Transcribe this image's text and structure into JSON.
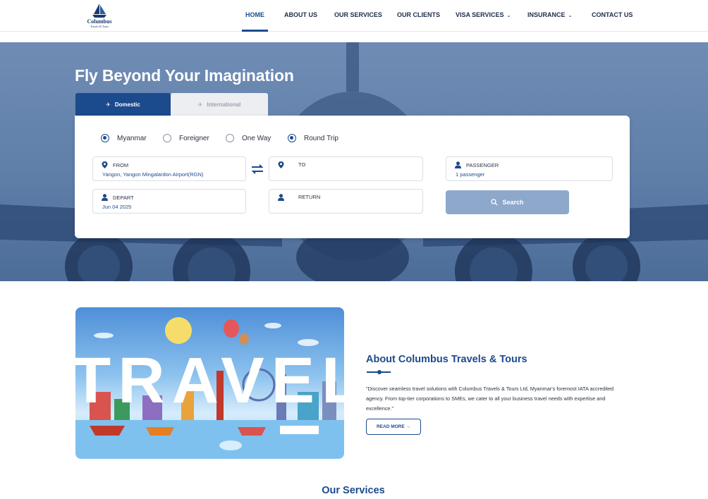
{
  "brand": {
    "name": "Columbus",
    "tagline": "Travels & Tours"
  },
  "nav": {
    "items": [
      {
        "label": "HOME",
        "active": true
      },
      {
        "label": "ABOUT US"
      },
      {
        "label": "OUR SERVICES"
      },
      {
        "label": "OUR CLIENTS"
      },
      {
        "label": "VISA SERVICES",
        "dropdown": true
      },
      {
        "label": "INSURANCE",
        "dropdown": true
      },
      {
        "label": "CONTACT US"
      }
    ]
  },
  "hero": {
    "title": "Fly Beyond Your Imagination",
    "tabs": [
      {
        "label": "Domestic",
        "active": true
      },
      {
        "label": "International"
      }
    ],
    "radios": {
      "myanmar": {
        "label": "Myanmar",
        "checked": true
      },
      "foreigner": {
        "label": "Foreigner",
        "checked": false
      },
      "one_way": {
        "label": "One Way",
        "checked": false
      },
      "round_trip": {
        "label": "Round Trip",
        "checked": true
      }
    },
    "fields": {
      "from": {
        "label": "FROM",
        "value": "Yangon, Yangon Mingalardon Airport(RGN)"
      },
      "to": {
        "label": "TO",
        "value": ""
      },
      "passenger": {
        "label": "PASSENGER",
        "value": "1 passenger"
      },
      "depart": {
        "label": "DEPART",
        "value": "Jun 04 2025"
      },
      "return": {
        "label": "RETURN",
        "value": ""
      }
    },
    "search_label": "Search"
  },
  "about": {
    "image_word": "TRAVEL",
    "title": "About Columbus Travels & Tours",
    "text": "\"Discover seamless travel solutions with Columbus Travels & Tours Ltd, Myanmar's foremost IATA accredited agency. From top-tier corporations to SMEs, we cater to all your business travel needs with expertise and excellence.\"",
    "read_more": "READ MORE →"
  },
  "services": {
    "title": "Our Services"
  },
  "colors": {
    "primary": "#1b4a8d",
    "hero_bg": "#5f7fa9",
    "search_button": "#8ea8cc"
  },
  "icons": [
    "plane-icon",
    "location-pin-icon",
    "user-icon",
    "swap-icon",
    "search-icon",
    "chevron-down-icon"
  ]
}
